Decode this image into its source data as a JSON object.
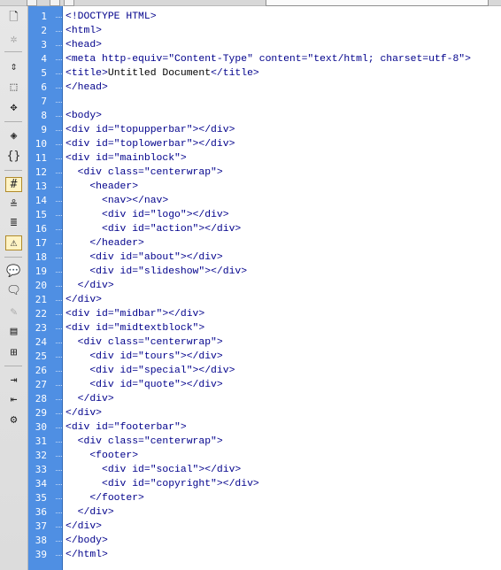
{
  "toolbar": {
    "buttons": [
      {
        "icon": "open-document-icon",
        "glyph": "🗋",
        "enabled": true
      },
      {
        "icon": "gear-icon",
        "glyph": "✲",
        "enabled": false
      },
      {
        "icon": "collapse-full-tag-icon",
        "glyph": "⇕",
        "enabled": true
      },
      {
        "icon": "collapse-selection-icon",
        "glyph": "⬚",
        "enabled": true
      },
      {
        "icon": "expand-all-icon",
        "glyph": "✥",
        "enabled": true
      },
      {
        "icon": "select-parent-tag-icon",
        "glyph": "◈",
        "enabled": true
      },
      {
        "icon": "balance-braces-icon",
        "glyph": "{}",
        "enabled": true
      },
      {
        "icon": "line-numbers-icon",
        "glyph": "#",
        "enabled": true,
        "pressed": true
      },
      {
        "icon": "highlight-invalid-code-icon",
        "glyph": "≗",
        "enabled": true
      },
      {
        "icon": "word-wrap-icon",
        "glyph": "≣",
        "enabled": true
      },
      {
        "icon": "syntax-error-alerts-icon",
        "glyph": "⚠",
        "enabled": true,
        "pressed": true
      },
      {
        "icon": "apply-comment-icon",
        "glyph": "💬",
        "enabled": true
      },
      {
        "icon": "remove-comment-icon",
        "glyph": "🗨",
        "enabled": true
      },
      {
        "icon": "wrap-tag-icon",
        "glyph": "✎",
        "enabled": false
      },
      {
        "icon": "recent-snippets-icon",
        "glyph": "▤",
        "enabled": true
      },
      {
        "icon": "move-css-icon",
        "glyph": "⊞",
        "enabled": true
      },
      {
        "icon": "indent-code-icon",
        "glyph": "⇥",
        "enabled": true
      },
      {
        "icon": "outdent-code-icon",
        "glyph": "⇤",
        "enabled": true
      },
      {
        "icon": "format-source-code-icon",
        "glyph": "⚙",
        "enabled": true
      }
    ]
  },
  "editor": {
    "line_numbers": [
      "1",
      "2",
      "3",
      "4",
      "5",
      "6",
      "7",
      "8",
      "9",
      "10",
      "11",
      "12",
      "13",
      "14",
      "15",
      "16",
      "17",
      "18",
      "19",
      "20",
      "21",
      "22",
      "23",
      "24",
      "25",
      "26",
      "27",
      "28",
      "29",
      "30",
      "31",
      "32",
      "33",
      "34",
      "35",
      "36",
      "37",
      "38",
      "39"
    ],
    "lines": [
      "<!DOCTYPE HTML>",
      "<html>",
      "<head>",
      "<meta http-equiv=\"Content-Type\" content=\"text/html; charset=utf-8\">",
      "<title>Untitled Document</title>",
      "</head>",
      "",
      "<body>",
      "<div id=\"topupperbar\"></div>",
      "<div id=\"toplowerbar\"></div>",
      "<div id=\"mainblock\">",
      "  <div class=\"centerwrap\">",
      "    <header>",
      "      <nav></nav>",
      "      <div id=\"logo\"></div>",
      "      <div id=\"action\"></div>",
      "    </header>",
      "    <div id=\"about\"></div>",
      "    <div id=\"slideshow\"></div>",
      "  </div>",
      "</div>",
      "<div id=\"midbar\"></div>",
      "<div id=\"midtextblock\">",
      "  <div class=\"centerwrap\">",
      "    <div id=\"tours\"></div>",
      "    <div id=\"special\"></div>",
      "    <div id=\"quote\"></div>",
      "  </div>",
      "</div>",
      "<div id=\"footerbar\">",
      "  <div class=\"centerwrap\">",
      "    <footer>",
      "      <div id=\"social\"></div>",
      "      <div id=\"copyright\"></div>",
      "    </footer>",
      "  </div>",
      "</div>",
      "</body>",
      "</html>"
    ]
  },
  "colors": {
    "gutter_background": "#4f8fe3",
    "tag_color": "#00008b",
    "text_color": "#000000"
  }
}
